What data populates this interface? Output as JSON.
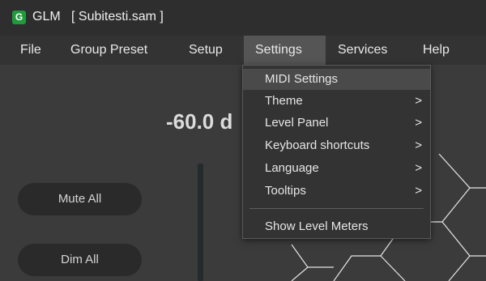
{
  "window": {
    "app_icon_letter": "G",
    "title": "GLM   [ Subitesti.sam ]"
  },
  "menubar": {
    "items": [
      {
        "label": "File"
      },
      {
        "label": "Group Preset"
      },
      {
        "label": "Setup"
      },
      {
        "label": "Settings",
        "active": true
      },
      {
        "label": "Services"
      },
      {
        "label": "Help"
      }
    ]
  },
  "main": {
    "level_readout": "-60.0 d",
    "mute_all_label": "Mute All",
    "dim_all_label": "Dim All"
  },
  "settings_menu": {
    "items": [
      {
        "label": "MIDI Settings",
        "submenu": false,
        "highlighted": true
      },
      {
        "label": "Theme",
        "submenu": true
      },
      {
        "label": "Level Panel",
        "submenu": true
      },
      {
        "label": "Keyboard shortcuts",
        "submenu": true
      },
      {
        "label": "Language",
        "submenu": true
      },
      {
        "label": "Tooltips",
        "submenu": true
      },
      {
        "label": "Show Level Meters",
        "submenu": false
      }
    ],
    "submenu_arrow": ">"
  },
  "colors": {
    "app_icon": "#1f9a3d",
    "background": "#3b3b3b",
    "menubar": "#333333",
    "active_menu": "#555555"
  }
}
